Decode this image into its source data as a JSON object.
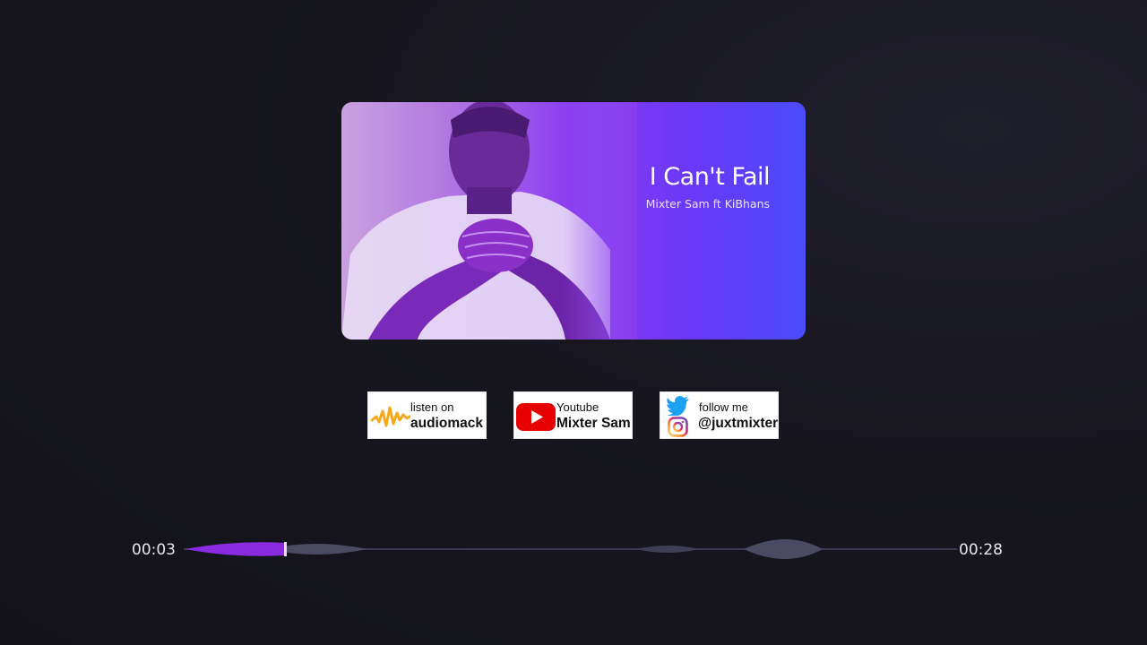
{
  "card": {
    "title": "I Can't Fail",
    "subtitle": "Mixter Sam ft KiBhans"
  },
  "badges": [
    {
      "small": "listen on",
      "big": "audiomack",
      "icon": "audiomack-icon"
    },
    {
      "small": "Youtube",
      "big": "Mixter Sam",
      "icon": "youtube-icon"
    },
    {
      "small": "follow me",
      "big": "@juxtmixter",
      "icon": [
        "twitter-icon",
        "instagram-icon"
      ]
    }
  ],
  "player": {
    "elapsed": "00:03",
    "duration": "00:28",
    "progress_fraction": 0.13
  },
  "colors": {
    "accent": "#8a2be2",
    "card_gradient_start": "#c9a1e0",
    "card_gradient_end": "#4a4bfa",
    "background": "#17161f",
    "waveform": "#4a4a62"
  }
}
